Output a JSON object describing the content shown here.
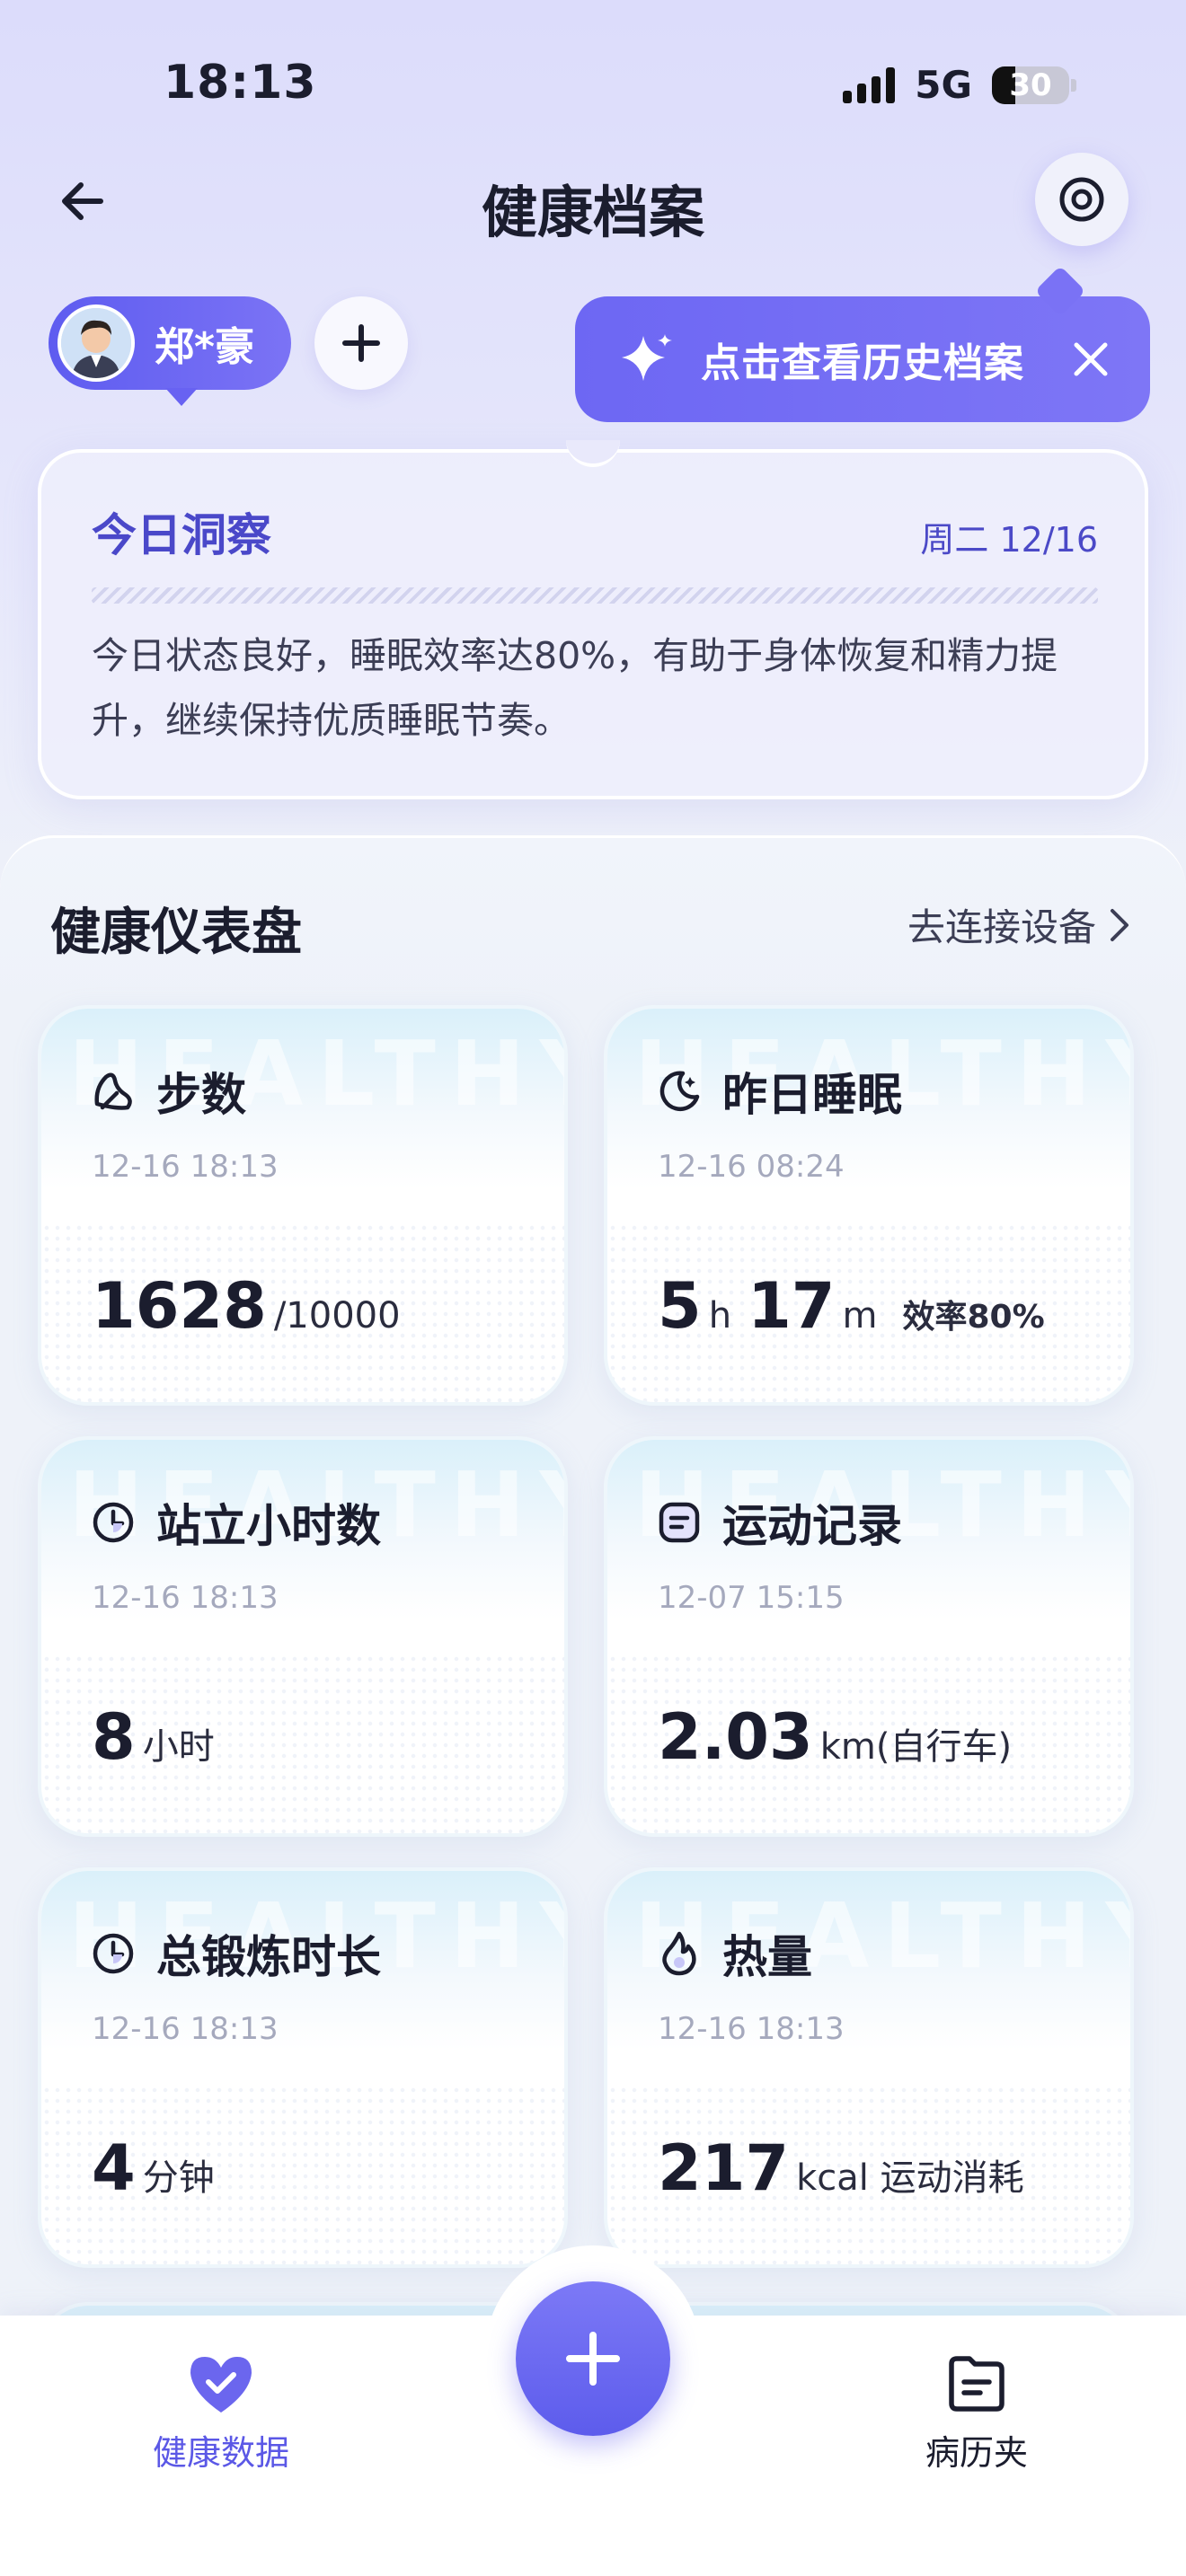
{
  "status_bar": {
    "time": "18:13",
    "network": "5G",
    "battery": "30",
    "battery_level": 0.3
  },
  "header": {
    "title": "健康档案",
    "back_icon": "arrow-left-icon",
    "settings_icon": "target-icon"
  },
  "user": {
    "name": "郑*豪"
  },
  "tooltip": {
    "text": "点击查看历史档案",
    "icon": "sparkle-icon"
  },
  "insight": {
    "title": "今日洞察",
    "date": "周二 12/16",
    "text": "今日状态良好，睡眠效率达80%，有助于身体恢复和精力提升，继续保持优质睡眠节奏。"
  },
  "dashboard": {
    "title": "健康仪表盘",
    "connect_label": "去连接设备",
    "watermark": "HEALTHY",
    "cards": [
      {
        "title": "步数",
        "icon": "steps-icon",
        "time": "12-16 18:13",
        "value": "1628",
        "unit": "/10000"
      },
      {
        "title": "昨日睡眠",
        "icon": "moon-icon",
        "time": "12-16 08:24",
        "hours": "5",
        "h_unit": "h",
        "minutes": "17",
        "m_unit": "m",
        "extra": "效率80%"
      },
      {
        "title": "站立小时数",
        "icon": "clock-icon",
        "time": "12-16 18:13",
        "value": "8",
        "unit": "小时"
      },
      {
        "title": "运动记录",
        "icon": "list-icon",
        "time": "12-07 15:15",
        "value": "2.03",
        "unit": "km(自行车)"
      },
      {
        "title": "总锻炼时长",
        "icon": "clock-icon",
        "time": "12-16 18:13",
        "value": "4",
        "unit": "分钟"
      },
      {
        "title": "热量",
        "icon": "flame-icon",
        "time": "12-16 18:13",
        "value": "217",
        "unit": "kcal 运动消耗"
      }
    ]
  },
  "nav": {
    "left_label": "健康数据",
    "right_label": "病历夹",
    "active_color": "#5b58e6"
  }
}
